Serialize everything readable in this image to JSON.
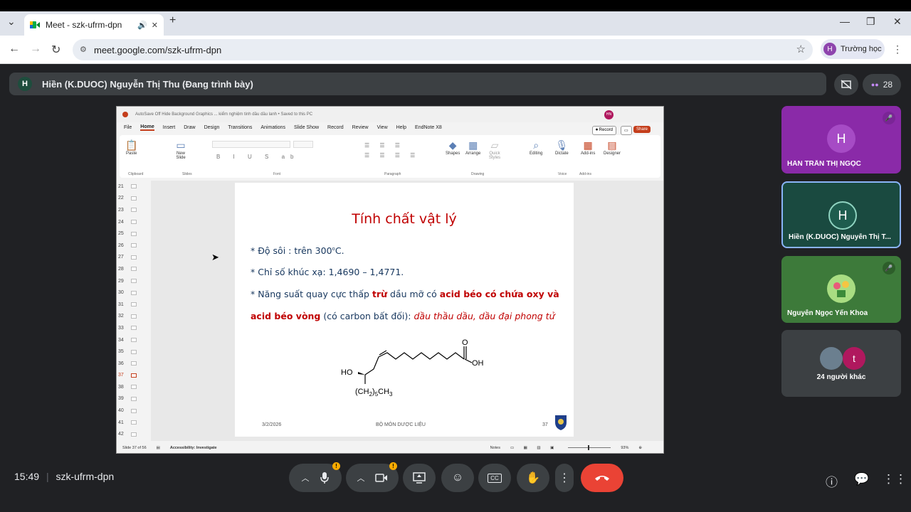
{
  "browser": {
    "tab_title": "Meet - szk-ufrm-dpn",
    "url": "meet.google.com/szk-ufrm-dpn",
    "profile_initial": "H",
    "profile_name": "Trường học"
  },
  "meet": {
    "presenter_initial": "H",
    "presenter_label": "Hiền (K.DUOC) Nguyễn Thị Thu (Đang trình bày)",
    "participant_count": "28",
    "time": "15:49",
    "meeting_code": "szk-ufrm-dpn"
  },
  "tiles": [
    {
      "initial": "H",
      "name": "HÂN TRẦN THỊ NGỌC",
      "bg": "#8a2aa8",
      "avatar_bg": "#a64bc5"
    },
    {
      "initial": "H",
      "name": "Hiền (K.DUOC) Nguyễn Thị T...",
      "bg": "#1a4a40",
      "avatar_bg": "#1e5c4e"
    },
    {
      "initial": "",
      "name": "Nguyễn Ngọc Yến Khoa",
      "bg": "#3d7a3a",
      "avatar_bg": "#9cd36e"
    },
    {
      "initial": "t",
      "name": "24 người khác",
      "bg": "#3c4043",
      "avatar_bg": "#b0185e"
    }
  ],
  "ppt": {
    "title_bar": "AutoSave  Off    Hide Background Graphics    ... kiểm nghiệm tinh dầu dầu lanh • Saved to this PC",
    "user_initials": "HN",
    "menu": [
      "File",
      "Home",
      "Insert",
      "Draw",
      "Design",
      "Transitions",
      "Animations",
      "Slide Show",
      "Record",
      "Review",
      "View",
      "Help",
      "EndNote X8"
    ],
    "record": "Record",
    "share": "Share",
    "ribbon": {
      "paste": "Paste",
      "new_slide": "New Slide",
      "shapes": "Shapes",
      "arrange": "Arrange",
      "quick_styles": "Quick Styles",
      "editing": "Editing",
      "dictate": "Dictate",
      "addins": "Add-ins",
      "designer": "Designer",
      "groups": [
        "Clipboard",
        "Slides",
        "Font",
        "Paragraph",
        "Drawing",
        "Voice",
        "Add-ins"
      ]
    },
    "thumb_numbers": [
      "21",
      "22",
      "23",
      "24",
      "25",
      "26",
      "27",
      "28",
      "29",
      "30",
      "31",
      "32",
      "33",
      "34",
      "35",
      "36",
      "37",
      "38",
      "39",
      "40",
      "41",
      "42"
    ],
    "status": {
      "slide": "Slide 37 of 56",
      "accessibility": "Accessibility: Investigate",
      "notes": "Notes",
      "zoom": "93%"
    }
  },
  "slide": {
    "title": "Tính chất vật lý",
    "line1_a": "* Độ sôi : trên 300",
    "line1_sup": "o",
    "line1_b": "C.",
    "line2": "* Chỉ số khúc xạ: 1,4690 – 1,4771.",
    "line3_a": "* Năng suất quay cực thấp ",
    "line3_bold1": "trừ",
    "line3_b": " dầu mỡ có ",
    "line3_bold2": "acid béo có chứa oxy và",
    "line4_bold": "acid béo vòng",
    "line4_a": " (có carbon bất đối): ",
    "line4_it": "dầu thầu dầu, dầu đại phong tử",
    "chem_oh": "OH",
    "chem_o": "O",
    "chem_ho": "HO",
    "chem_tail_a": "(CH",
    "chem_tail_sub1": "2",
    "chem_tail_b": ")",
    "chem_tail_sub2": "5",
    "chem_tail_c": "CH",
    "chem_tail_sub3": "3",
    "footer_date": "3/2/2026",
    "footer_center": "BỘ MÔN DƯỢC LIỆU",
    "footer_page": "37"
  }
}
